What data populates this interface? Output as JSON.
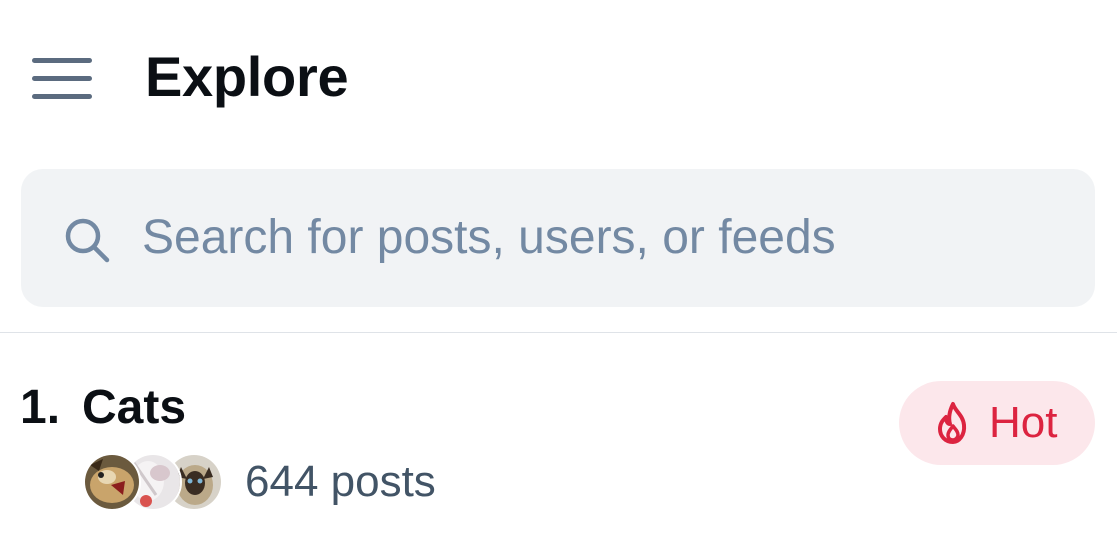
{
  "header": {
    "title": "Explore",
    "menu_icon": "hamburger-menu-icon"
  },
  "search": {
    "placeholder": "Search for posts, users, or feeds",
    "icon": "search-icon"
  },
  "trending": [
    {
      "rank": "1.",
      "name": "Cats",
      "count": "644 posts",
      "badge": {
        "label": "Hot",
        "icon": "fire-icon"
      }
    }
  ],
  "colors": {
    "accent_hot": "#dc2440",
    "hot_badge_bg": "#fce7eb",
    "search_bg": "#f1f3f5",
    "muted_text": "#7389a3",
    "title_text": "#0b0f14"
  }
}
